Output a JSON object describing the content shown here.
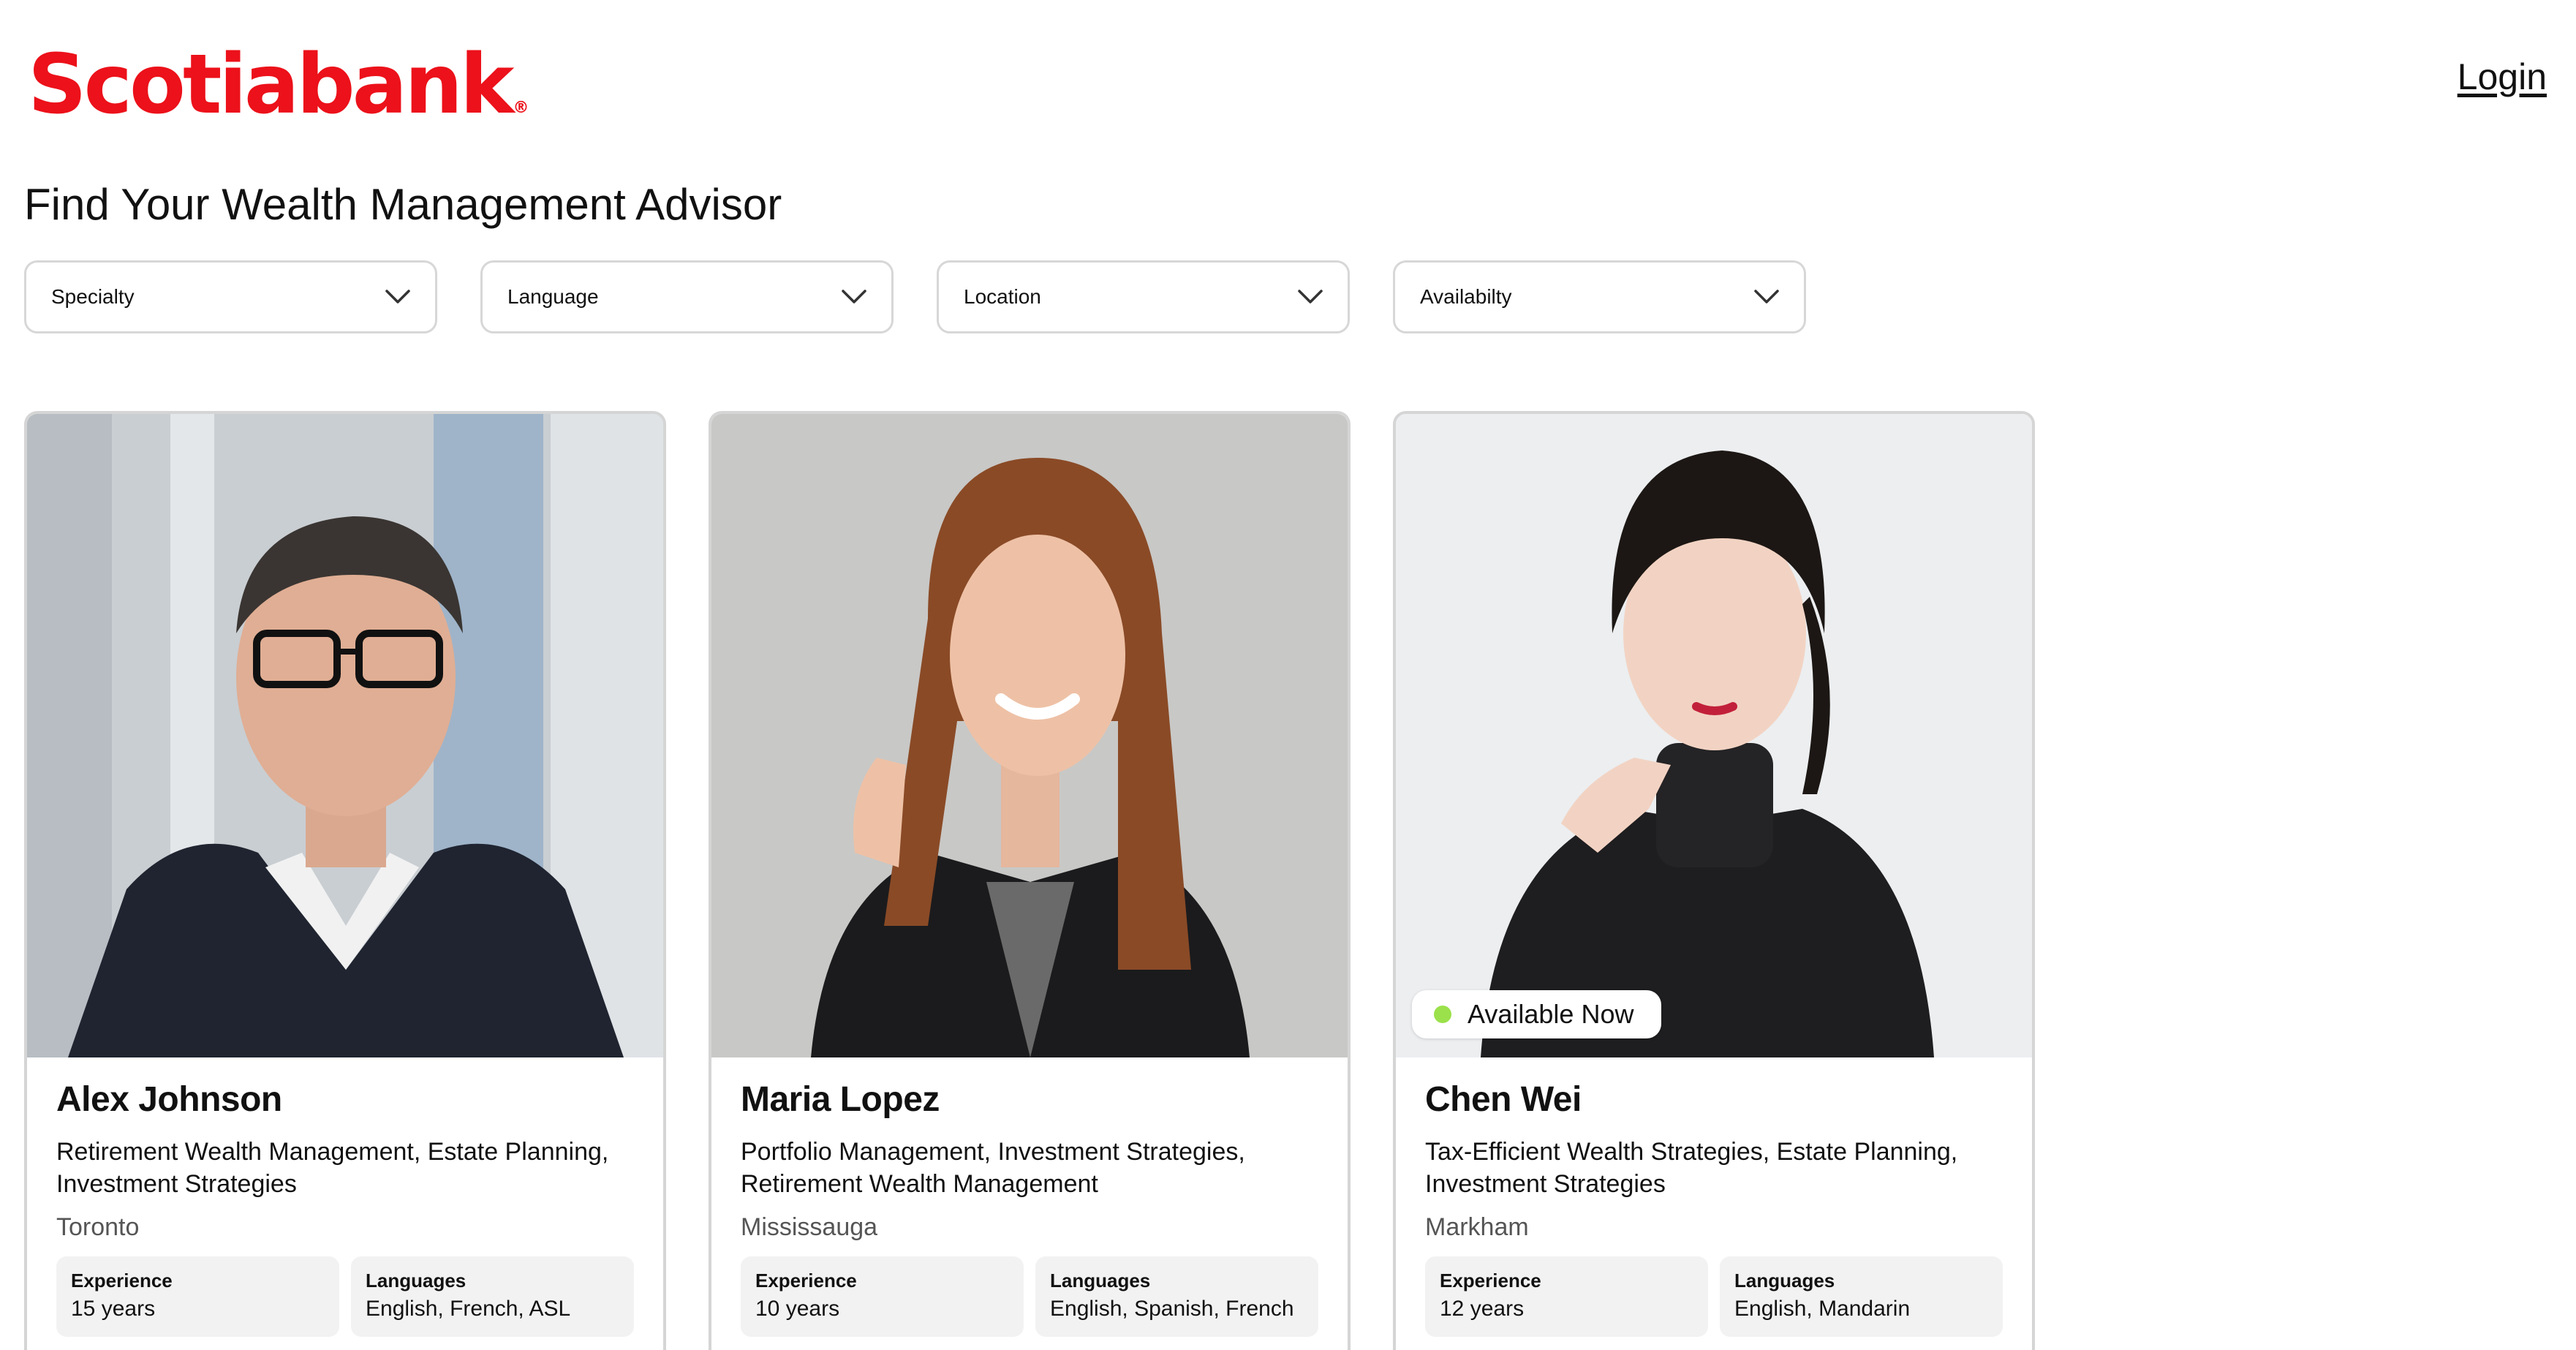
{
  "header": {
    "logo_text": "Scotiabank",
    "logo_reg": "®",
    "login_label": "Login"
  },
  "page": {
    "title": "Find Your Wealth Management Advisor"
  },
  "filters": [
    {
      "label": "Specialty"
    },
    {
      "label": "Language"
    },
    {
      "label": "Location"
    },
    {
      "label": "Availabilty"
    }
  ],
  "advisors": [
    {
      "name": "Alex Johnson",
      "specialties": "Retirement Wealth Management, Estate Planning, Investment Strategies",
      "location": "Toronto",
      "experience_label": "Experience",
      "experience_value": "15 years",
      "languages_label": "Languages",
      "languages_value": "English, French, ASL"
    },
    {
      "name": "Maria Lopez",
      "specialties": "Portfolio Management, Investment Strategies, Retirement Wealth Management",
      "location": "Mississauga",
      "experience_label": "Experience",
      "experience_value": "10 years",
      "languages_label": "Languages",
      "languages_value": "English, Spanish, French"
    },
    {
      "name": "Chen Wei",
      "specialties": "Tax-Efficient Wealth Strategies, Estate Planning, Investment Strategies",
      "location": "Markham",
      "experience_label": "Experience",
      "experience_value": "12 years",
      "languages_label": "Languages",
      "languages_value": "English, Mandarin",
      "badge": "Available Now"
    }
  ],
  "colors": {
    "brand": "#EC111A",
    "available_dot": "#9BE14B"
  }
}
